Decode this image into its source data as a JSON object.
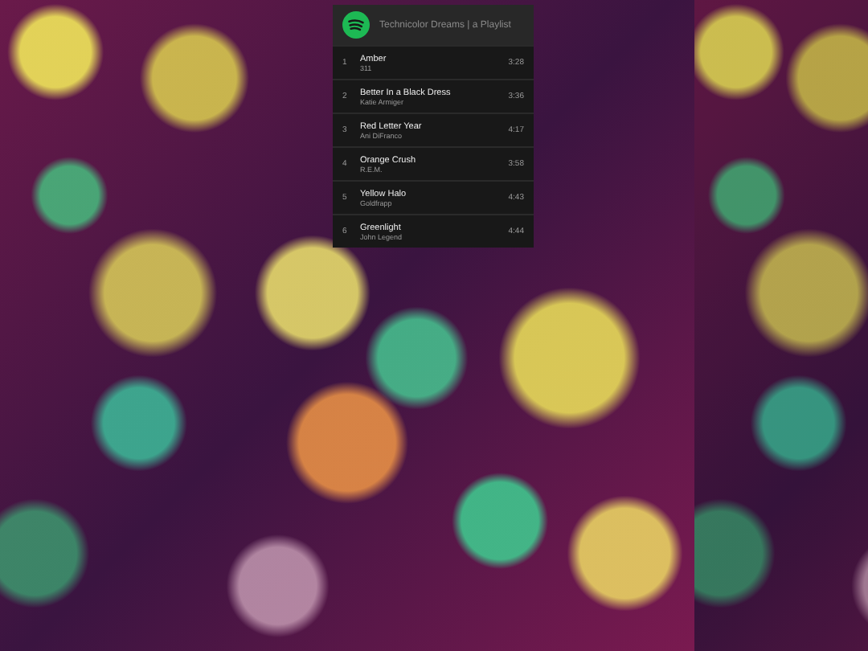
{
  "widget": {
    "title": "Technicolor Dreams | a Playlist"
  },
  "tracks": [
    {
      "number": "1",
      "title": "Amber",
      "artist": "311",
      "duration": "3:28"
    },
    {
      "number": "2",
      "title": "Better In a Black Dress",
      "artist": "Katie Armiger",
      "duration": "3:36"
    },
    {
      "number": "3",
      "title": "Red Letter Year",
      "artist": "Ani DiFranco",
      "duration": "4:17"
    },
    {
      "number": "4",
      "title": "Orange Crush",
      "artist": "R.E.M.",
      "duration": "3:58"
    },
    {
      "number": "5",
      "title": "Yellow Halo",
      "artist": "Goldfrapp",
      "duration": "4:43"
    },
    {
      "number": "6",
      "title": "Greenlight",
      "artist": "John Legend",
      "duration": "4:44"
    }
  ]
}
